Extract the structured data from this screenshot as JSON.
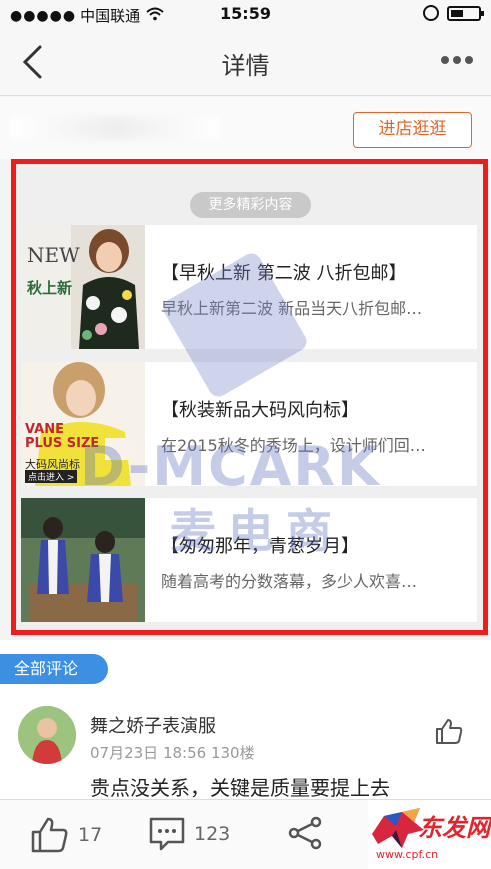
{
  "status_bar": {
    "signal_dots": "●●●●●",
    "carrier": "中国联通",
    "time": "15:59"
  },
  "nav": {
    "title": "详情"
  },
  "shop": {
    "visit_label": "进店逛逛"
  },
  "feature": {
    "more_label": "更多精彩内容",
    "cards": [
      {
        "title": "【早秋上新 第二波 八折包邮】",
        "desc": "早秋上新第二波 新品当天八折包邮…",
        "thumb_text_1": "NEW",
        "thumb_text_2": "秋上新"
      },
      {
        "title": "【秋装新品大码风向标】",
        "desc": "在2015秋冬的秀场上，设计师们回…",
        "thumb_text_1": "VANE",
        "thumb_text_2": "PLUS SIZE",
        "thumb_text_3": "大码风尚标",
        "thumb_text_4": "点击进入 >"
      },
      {
        "title": "【匆匆那年，青葱岁月】",
        "desc": "随着高考的分数落幕，多少人欢喜…"
      }
    ]
  },
  "watermark": {
    "brand": "D-MCARK",
    "cn": "麦电商"
  },
  "comments": {
    "section_label": "全部评论",
    "items": [
      {
        "username": "舞之娇子表演服",
        "meta": "07月23日 18:56 130楼",
        "text": "贵点没关系，关键是质量要提上去"
      }
    ]
  },
  "bottom_bar": {
    "likes": "17",
    "comments": "123"
  },
  "logo": {
    "text": "东发网",
    "url": "www.cpf.cn"
  },
  "colors": {
    "accent_orange": "#e2672c",
    "frame_red": "#ee1c1c",
    "tag_blue": "#3d8fe4"
  }
}
